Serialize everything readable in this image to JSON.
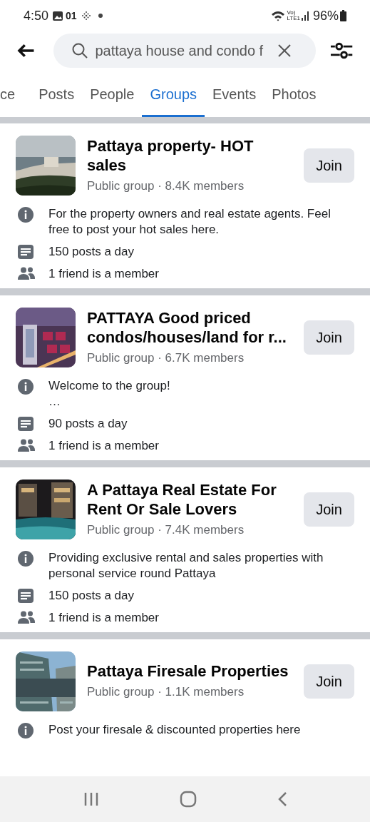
{
  "status_bar": {
    "time": "4:50",
    "notification_count": "01",
    "network_top": "Vo)",
    "network_bottom": "LTE1",
    "battery": "96%"
  },
  "search": {
    "value": "pattaya house and condo f"
  },
  "tabs": [
    {
      "label": "ce",
      "selected": false
    },
    {
      "label": "Posts",
      "selected": false
    },
    {
      "label": "People",
      "selected": false
    },
    {
      "label": "Groups",
      "selected": true
    },
    {
      "label": "Events",
      "selected": false
    },
    {
      "label": "Photos",
      "selected": false
    }
  ],
  "groups": [
    {
      "thumbnail": {
        "kind": "picture"
      },
      "name": "Pattaya property- HOT sales",
      "meta": "Public group · 8.4K members",
      "button": "Join",
      "details": [
        {
          "kind": "info",
          "text": "For the property owners and real estate agents. Feel free to post your hot sales here."
        },
        {
          "kind": "posts",
          "text": "150 posts a day"
        },
        {
          "kind": "friends",
          "text": "1 friend is a member"
        }
      ]
    },
    {
      "thumbnail": {
        "kind": "picture"
      },
      "name": "PATTAYA Good priced condos/houses/land for r...",
      "meta": "Public group · 6.7K members",
      "button": "Join",
      "details": [
        {
          "kind": "info",
          "text": "Welcome to the group!\n…"
        },
        {
          "kind": "posts",
          "text": "90 posts a day"
        },
        {
          "kind": "friends",
          "text": "1 friend is a member"
        }
      ]
    },
    {
      "thumbnail": {
        "kind": "picture"
      },
      "name": "A Pattaya Real Estate For Rent Or Sale Lovers",
      "meta": "Public group · 7.4K members",
      "button": "Join",
      "details": [
        {
          "kind": "info",
          "text": "Providing exclusive rental and sales properties with personal service round Pattaya"
        },
        {
          "kind": "posts",
          "text": "150 posts a day"
        },
        {
          "kind": "friends",
          "text": "1 friend is a member"
        }
      ]
    },
    {
      "thumbnail": {
        "kind": "picture"
      },
      "name": "Pattaya Firesale Properties",
      "meta": "Public group · 1.1K members",
      "button": "Join",
      "details": [
        {
          "kind": "info",
          "text": "Post your firesale & discounted properties here"
        }
      ]
    }
  ]
}
